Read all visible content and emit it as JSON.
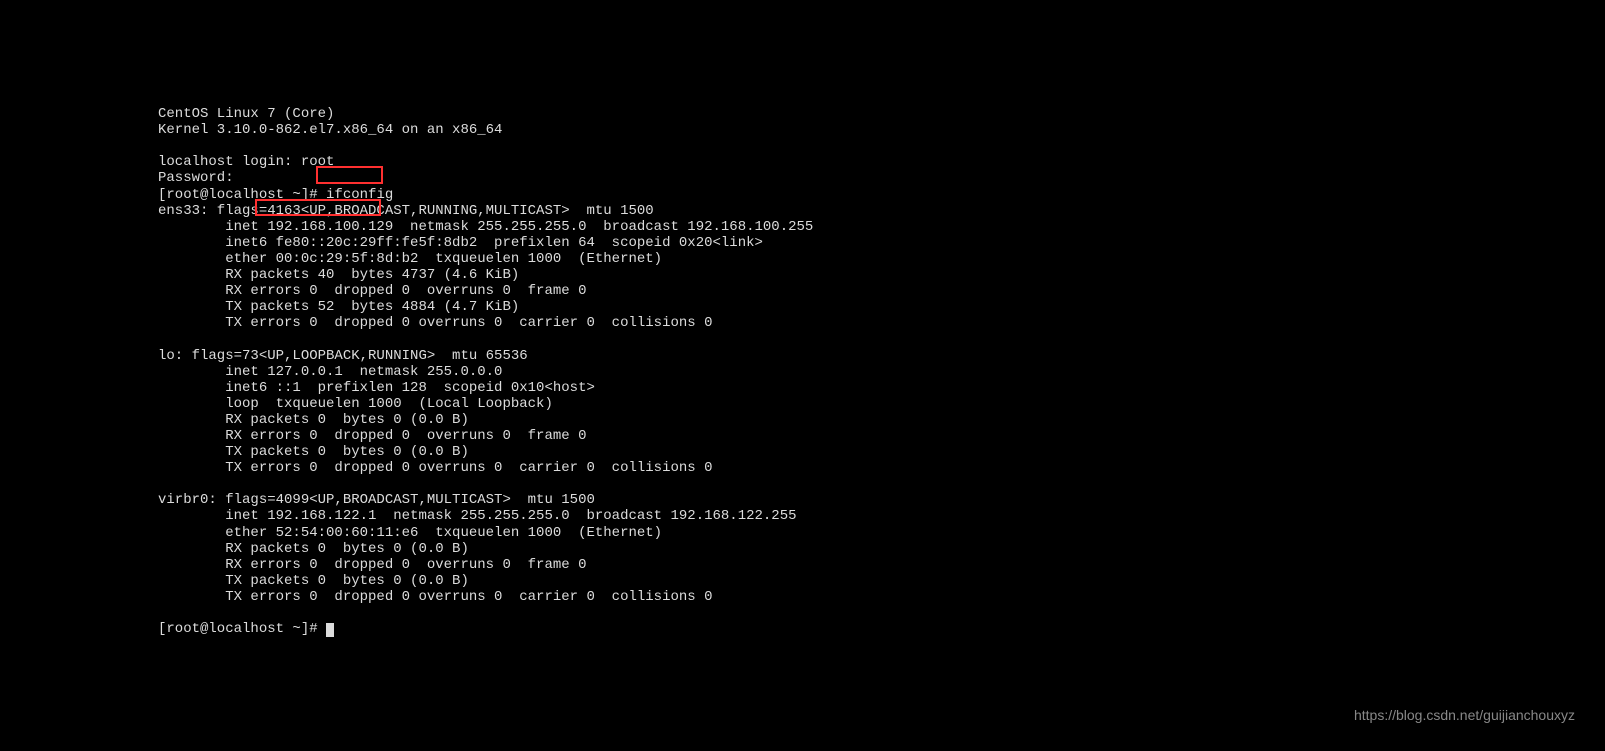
{
  "os_banner": "CentOS Linux 7 (Core)",
  "kernel_line": "Kernel 3.10.0-862.el7.x86_64 on an x86_64",
  "login_prompt": "localhost login: root",
  "password_prompt": "Password:",
  "shell_prompt_1": "[root@localhost ~]# ",
  "command_1": "ifconfig",
  "ens33": {
    "header": "ens33: flags=4163<UP,BROADCAST,RUNNING,MULTICAST>  mtu 1500",
    "inet": "        inet 192.168.100.129  netmask 255.255.255.0  broadcast 192.168.100.255",
    "inet6": "        inet6 fe80::20c:29ff:fe5f:8db2  prefixlen 64  scopeid 0x20<link>",
    "ether": "        ether 00:0c:29:5f:8d:b2  txqueuelen 1000  (Ethernet)",
    "rx_packets": "        RX packets 40  bytes 4737 (4.6 KiB)",
    "rx_errors": "        RX errors 0  dropped 0  overruns 0  frame 0",
    "tx_packets": "        TX packets 52  bytes 4884 (4.7 KiB)",
    "tx_errors": "        TX errors 0  dropped 0 overruns 0  carrier 0  collisions 0"
  },
  "lo": {
    "header": "lo: flags=73<UP,LOOPBACK,RUNNING>  mtu 65536",
    "inet": "        inet 127.0.0.1  netmask 255.0.0.0",
    "inet6": "        inet6 ::1  prefixlen 128  scopeid 0x10<host>",
    "loop": "        loop  txqueuelen 1000  (Local Loopback)",
    "rx_packets": "        RX packets 0  bytes 0 (0.0 B)",
    "rx_errors": "        RX errors 0  dropped 0  overruns 0  frame 0",
    "tx_packets": "        TX packets 0  bytes 0 (0.0 B)",
    "tx_errors": "        TX errors 0  dropped 0 overruns 0  carrier 0  collisions 0"
  },
  "virbr0": {
    "header": "virbr0: flags=4099<UP,BROADCAST,MULTICAST>  mtu 1500",
    "inet": "        inet 192.168.122.1  netmask 255.255.255.0  broadcast 192.168.122.255",
    "ether": "        ether 52:54:00:60:11:e6  txqueuelen 1000  (Ethernet)",
    "rx_packets": "        RX packets 0  bytes 0 (0.0 B)",
    "rx_errors": "        RX errors 0  dropped 0  overruns 0  frame 0",
    "tx_packets": "        TX packets 0  bytes 0 (0.0 B)",
    "tx_errors": "        TX errors 0  dropped 0 overruns 0  carrier 0  collisions 0"
  },
  "shell_prompt_2": "[root@localhost ~]# ",
  "watermark": "https://blog.csdn.net/guijianchouxyz"
}
